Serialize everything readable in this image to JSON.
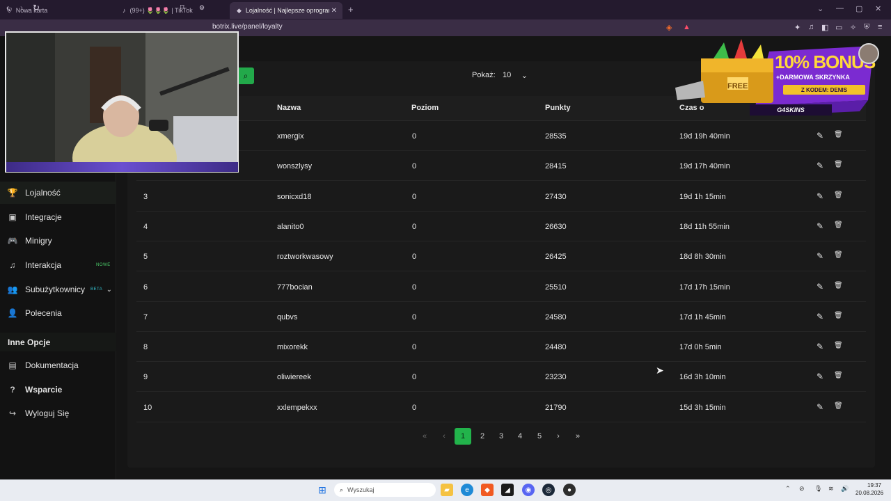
{
  "browser": {
    "tabs": [
      {
        "title": "Nowa karta",
        "icon": "⛨"
      },
      {
        "title": "(99+) 🌷🌷🌷 | TikTok",
        "icon": "♪"
      },
      {
        "title": "Lojalność | Najlepsze oprogramo",
        "icon": "◆"
      }
    ],
    "new_tab": "+",
    "url": "botrix.live/panel/loyalty"
  },
  "sidebar": {
    "items": [
      {
        "label": "Lojalność",
        "icon": "🏆",
        "badge": ""
      },
      {
        "label": "Integracje",
        "icon": "▣",
        "badge": ""
      },
      {
        "label": "Minigry",
        "icon": "🎮",
        "badge": ""
      },
      {
        "label": "Interakcja",
        "icon": "♫",
        "badge": "NOWE"
      },
      {
        "label": "Subużytkownicy",
        "icon": "👥",
        "badge": "BETA"
      },
      {
        "label": "Polecenia",
        "icon": "👤",
        "badge": ""
      }
    ],
    "other_heading": "Inne Opcje",
    "other_items": [
      {
        "label": "Dokumentacja",
        "icon": "▤"
      },
      {
        "label": "Wsparcie",
        "icon": "?"
      },
      {
        "label": "Wyloguj Się",
        "icon": "↪"
      }
    ]
  },
  "toolbar": {
    "show_label": "Pokaż:",
    "show_value": "10"
  },
  "table": {
    "headers": [
      "Nazwa",
      "Poziom",
      "Punkty",
      "Czas o"
    ],
    "rows": [
      {
        "rank": "",
        "name": "xmergix",
        "level": "0",
        "points": "28535",
        "time": "19d 19h 40min"
      },
      {
        "rank": "",
        "name": "wonszlysy",
        "level": "0",
        "points": "28415",
        "time": "19d 17h 40min"
      },
      {
        "rank": "3",
        "name": "sonicxd18",
        "level": "0",
        "points": "27430",
        "time": "19d 1h 15min"
      },
      {
        "rank": "4",
        "name": "alanito0",
        "level": "0",
        "points": "26630",
        "time": "18d 11h 55min"
      },
      {
        "rank": "5",
        "name": "roztworkwasowy",
        "level": "0",
        "points": "26425",
        "time": "18d 8h 30min"
      },
      {
        "rank": "6",
        "name": "777bocian",
        "level": "0",
        "points": "25510",
        "time": "17d 17h 15min"
      },
      {
        "rank": "7",
        "name": "qubvs",
        "level": "0",
        "points": "24580",
        "time": "17d 1h 45min"
      },
      {
        "rank": "8",
        "name": "mixorekk",
        "level": "0",
        "points": "24480",
        "time": "17d 0h 5min"
      },
      {
        "rank": "9",
        "name": "oliwiereek",
        "level": "0",
        "points": "23230",
        "time": "16d 3h 10min"
      },
      {
        "rank": "10",
        "name": "xxlempekxx",
        "level": "0",
        "points": "21790",
        "time": "15d 3h 15min"
      }
    ]
  },
  "pagination": {
    "first": "«",
    "prev": "‹",
    "pages": [
      "1",
      "2",
      "3",
      "4",
      "5"
    ],
    "current": "1",
    "next": "›",
    "last": "»"
  },
  "ad": {
    "headline": "10% BONUS",
    "line2": "+DARMOWA SKRZYNKA",
    "line3": "Z KODEM: DENIS",
    "brand": "G4SKINS",
    "chest": "FREE"
  },
  "taskbar": {
    "search_placeholder": "Wyszukaj",
    "time": "19:37",
    "date": "20.08.2026"
  },
  "colors": {
    "accent": "#22b34b",
    "background": "#151515",
    "browser": "#3a2d45"
  }
}
